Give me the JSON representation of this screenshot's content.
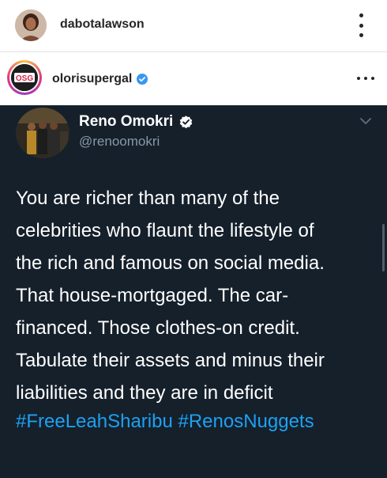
{
  "top_header": {
    "username": "dabotalawson"
  },
  "post": {
    "username": "olorisupergal",
    "avatar_logo_text": "OSG",
    "verified": true
  },
  "tweet": {
    "display_name": "Reno Omokri",
    "handle": "@renoomokri",
    "verified": true,
    "text": "You are richer than many of the\ncelebrities who flaunt the lifestyle of\nthe rich and famous on social media.\nThat house-mortgaged. The car-\nfinanced. Those clothes-on credit.\nTabulate their assets and minus their\nliabilities and they are in deficit",
    "hashtags": "#FreeLeahSharibu #RenosNuggets"
  },
  "icons": {
    "top_menu": "more-vertical-icon",
    "post_menu": "more-horizontal-icon",
    "verified": "verified-badge-icon",
    "tweet_menu": "chevron-down-icon"
  },
  "colors": {
    "tweet_background": "#15202b",
    "link": "#1da1f2",
    "verified_instagram": "#3897f0",
    "handle": "#8899a6"
  }
}
